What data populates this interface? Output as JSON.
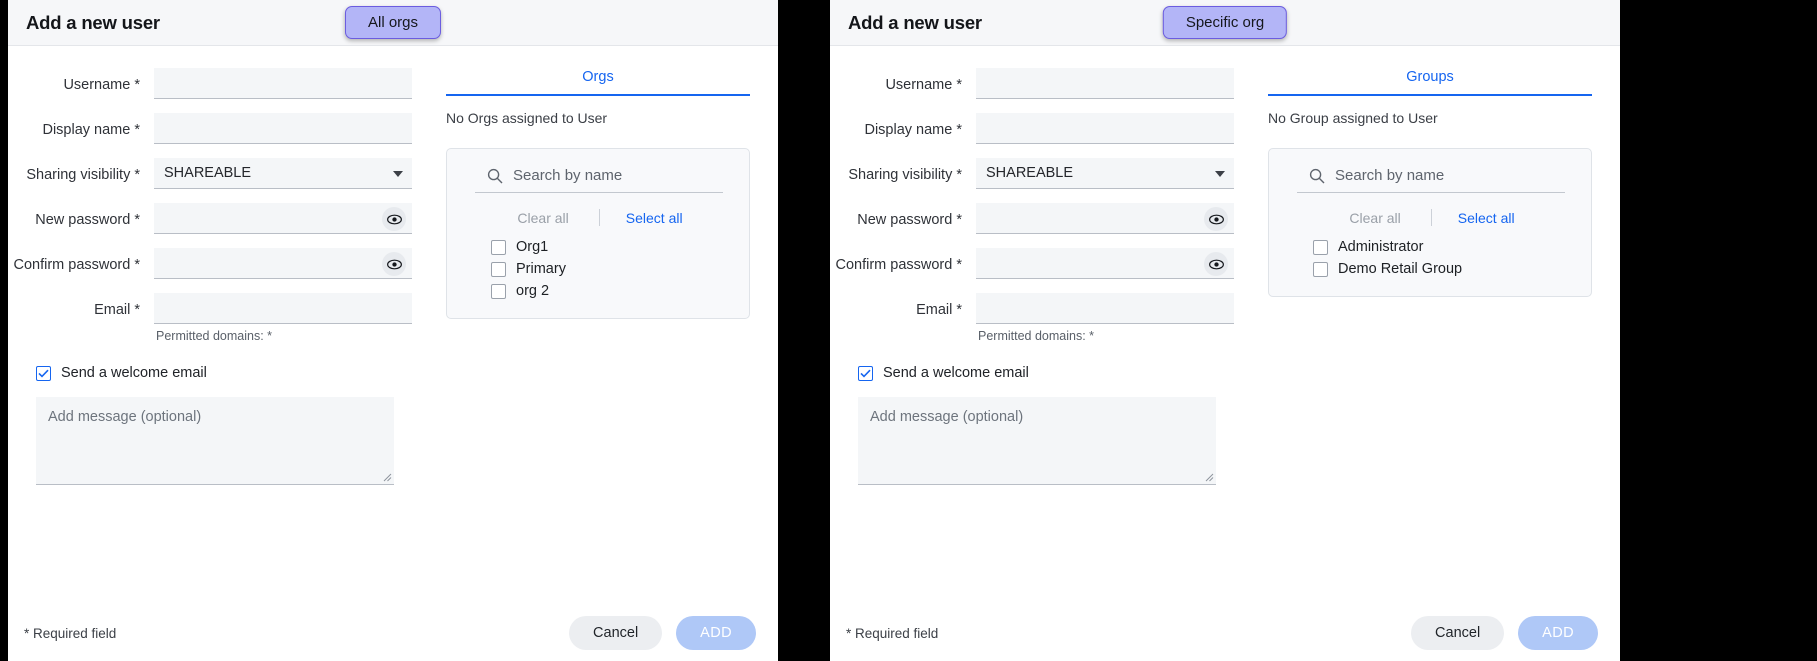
{
  "dialogs": [
    {
      "title": "Add a new user",
      "mode_pill": "All orgs",
      "fields": {
        "username_label": "Username *",
        "username_value": "",
        "display_name_label": "Display name *",
        "display_name_value": "",
        "sharing_label": "Sharing visibility *",
        "sharing_value": "SHAREABLE",
        "new_password_label": "New password *",
        "new_password_value": "",
        "confirm_password_label": "Confirm password *",
        "confirm_password_value": "",
        "email_label": "Email *",
        "email_value": "",
        "permitted_domains": "Permitted domains: *"
      },
      "welcome_checkbox_label": "Send a welcome email",
      "welcome_checkbox_checked": true,
      "message_placeholder": "Add message (optional)",
      "panel": {
        "tab_label": "Orgs",
        "empty_note": "No Orgs assigned to User",
        "search_placeholder": "Search by name",
        "clear_all": "Clear all",
        "select_all": "Select all",
        "options": [
          {
            "label": "Org1",
            "checked": false
          },
          {
            "label": "Primary",
            "checked": false
          },
          {
            "label": "org 2",
            "checked": false
          }
        ]
      },
      "footer": {
        "required_note": "* Required field",
        "cancel": "Cancel",
        "add": "ADD"
      }
    },
    {
      "title": "Add a new user",
      "mode_pill": "Specific org",
      "fields": {
        "username_label": "Username *",
        "username_value": "",
        "display_name_label": "Display name *",
        "display_name_value": "",
        "sharing_label": "Sharing visibility *",
        "sharing_value": "SHAREABLE",
        "new_password_label": "New password *",
        "new_password_value": "",
        "confirm_password_label": "Confirm password *",
        "confirm_password_value": "",
        "email_label": "Email *",
        "email_value": "",
        "permitted_domains": "Permitted domains: *"
      },
      "welcome_checkbox_label": "Send a welcome email",
      "welcome_checkbox_checked": true,
      "message_placeholder": "Add message (optional)",
      "panel": {
        "tab_label": "Groups",
        "empty_note": "No Group assigned to User",
        "search_placeholder": "Search by name",
        "clear_all": "Clear all",
        "select_all": "Select all",
        "options": [
          {
            "label": "Administrator",
            "checked": false
          },
          {
            "label": "Demo Retail Group",
            "checked": false
          }
        ]
      },
      "footer": {
        "required_note": "* Required field",
        "cancel": "Cancel",
        "add": "ADD"
      }
    }
  ],
  "colors": {
    "accent_blue": "#1565f0",
    "pill_fill": "#b3b5f7",
    "pill_border": "#6b5ce0",
    "add_button": "#afc8f7",
    "field_fill": "#f4f6f8"
  },
  "icons": {
    "search": "search-icon",
    "eye": "eye-icon",
    "caret": "chevron-down-icon",
    "checkmark": "check-icon",
    "resize": "resize-grip-icon"
  }
}
